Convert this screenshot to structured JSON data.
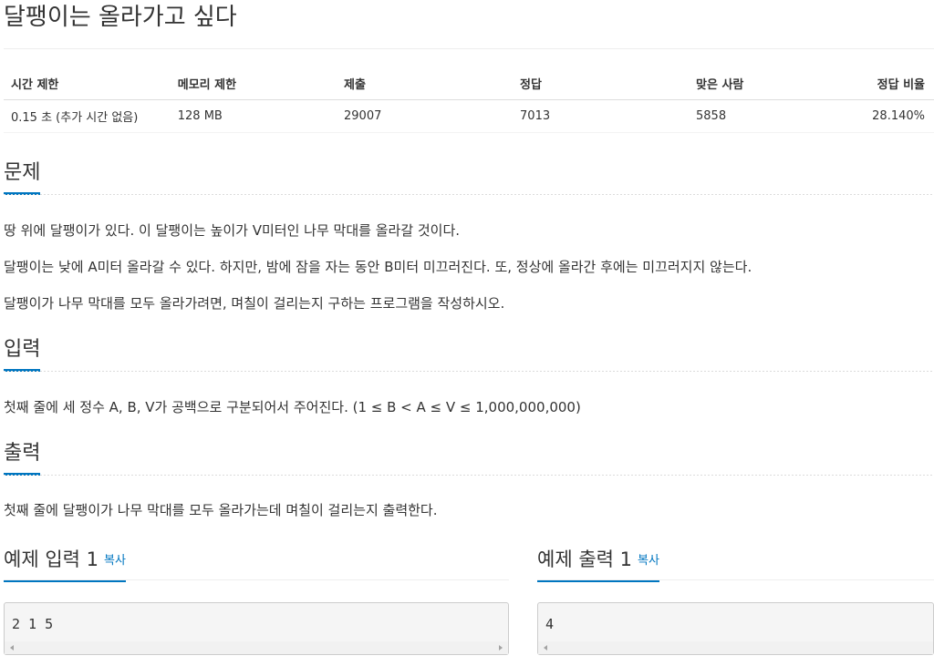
{
  "problem": {
    "title": "달팽이는 올라가고 싶다"
  },
  "info": {
    "headers": [
      "시간 제한",
      "메모리 제한",
      "제출",
      "정답",
      "맞은 사람",
      "정답 비율"
    ],
    "values": [
      "0.15 초 (추가 시간 없음)",
      "128 MB",
      "29007",
      "7013",
      "5858",
      "28.140%"
    ]
  },
  "sections": {
    "description": {
      "heading": "문제",
      "paragraphs": [
        "땅 위에 달팽이가 있다. 이 달팽이는 높이가 V미터인 나무 막대를 올라갈 것이다.",
        "달팽이는 낮에 A미터 올라갈 수 있다. 하지만, 밤에 잠을 자는 동안 B미터 미끄러진다. 또, 정상에 올라간 후에는 미끄러지지 않는다.",
        "달팽이가 나무 막대를 모두 올라가려면, 며칠이 걸리는지 구하는 프로그램을 작성하시오."
      ]
    },
    "input": {
      "heading": "입력",
      "paragraphs": [
        "첫째 줄에 세 정수 A, B, V가 공백으로 구분되어서 주어진다. (1 ≤ B < A ≤ V ≤ 1,000,000,000)"
      ]
    },
    "output": {
      "heading": "출력",
      "paragraphs": [
        "첫째 줄에 달팽이가 나무 막대를 모두 올라가는데 며칠이 걸리는지 출력한다."
      ]
    }
  },
  "samples": {
    "input": {
      "heading": "예제 입력 1",
      "copy_label": "복사",
      "content": "2 1 5"
    },
    "output": {
      "heading": "예제 출력 1",
      "copy_label": "복사",
      "content": "4"
    }
  },
  "colors": {
    "accent": "#0076c0",
    "text": "#333333",
    "code_background": "#f5f5f5"
  }
}
